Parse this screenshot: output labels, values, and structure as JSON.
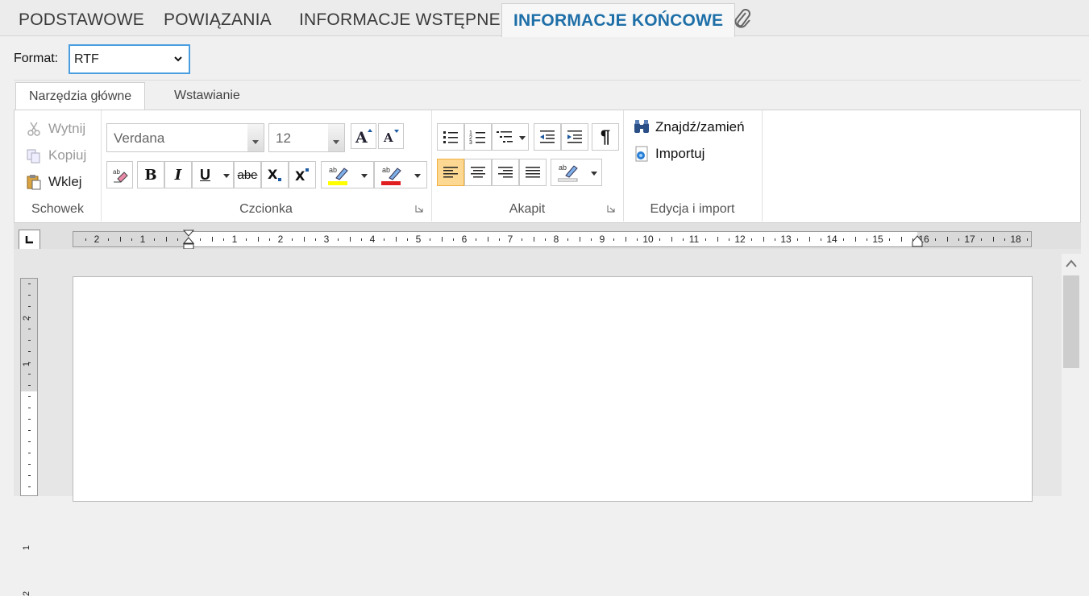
{
  "top_tabs": [
    "PODSTAWOWE",
    "POWIĄZANIA",
    "INFORMACJE WSTĘPNE",
    "INFORMACJE KOŃCOWE"
  ],
  "format": {
    "label": "Format:",
    "value": "RTF"
  },
  "ribbon_tabs": [
    "Narzędzia główne",
    "Wstawianie"
  ],
  "clipboard": {
    "cut": "Wytnij",
    "copy": "Kopiuj",
    "paste": "Wklej",
    "group": "Schowek"
  },
  "font": {
    "family": "Verdana",
    "size": "12",
    "group": "Czcionka"
  },
  "paragraph": {
    "group": "Akapit"
  },
  "edit": {
    "find": "Znajdź/zamień",
    "import": "Importuj",
    "group": "Edycja i import"
  },
  "ruler": {
    "h_numbers": [
      "2",
      "1",
      "1",
      "2",
      "3",
      "4",
      "5",
      "6",
      "7",
      "8",
      "9",
      "10",
      "11",
      "12",
      "13",
      "14",
      "15",
      "16",
      "17",
      "18"
    ],
    "v_numbers": [
      "2",
      "1",
      "1",
      "2"
    ]
  },
  "colors": {
    "accent": "#1e6fa8",
    "select_border": "#4a9ee0",
    "highlight_yellow": "#ffff00",
    "font_red": "#e02020"
  }
}
